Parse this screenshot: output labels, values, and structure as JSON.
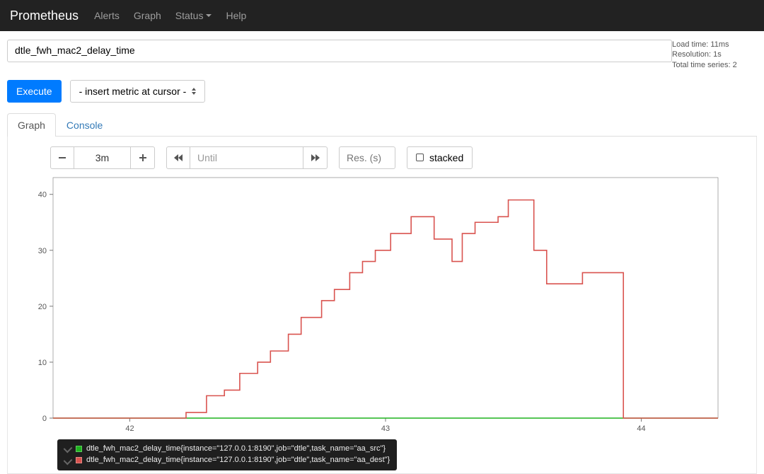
{
  "nav": {
    "brand": "Prometheus",
    "items": [
      "Alerts",
      "Graph",
      "Status",
      "Help"
    ]
  },
  "expression": "dtle_fwh_mac2_delay_time",
  "stats": {
    "load_time": "Load time: 11ms",
    "resolution": "Resolution: 1s",
    "total_series": "Total time series: 2"
  },
  "actions": {
    "execute": "Execute",
    "insert_metric": "- insert metric at cursor -"
  },
  "tabs": {
    "graph": "Graph",
    "console": "Console"
  },
  "controls": {
    "range": "3m",
    "until_placeholder": "Until",
    "res_placeholder": "Res. (s)",
    "stacked": "stacked"
  },
  "chart_data": {
    "type": "line",
    "x": [
      42,
      43,
      44
    ],
    "ylim": [
      0,
      40
    ],
    "yticks": [
      0,
      10,
      20,
      30,
      40
    ],
    "xticks": [
      42,
      43,
      44
    ],
    "series": [
      {
        "name": "dtle_fwh_mac2_delay_time{instance=\"127.0.0.1:8190\",job=\"dtle\",task_name=\"aa_src\"}",
        "color": "#1eb41e",
        "points": [
          [
            41.7,
            0
          ],
          [
            44.3,
            0
          ]
        ]
      },
      {
        "name": "dtle_fwh_mac2_delay_time{instance=\"127.0.0.1:8190\",job=\"dtle\",task_name=\"aa_dest\"}",
        "color": "#d9534f",
        "points": [
          [
            41.7,
            0
          ],
          [
            42.22,
            0
          ],
          [
            42.22,
            1
          ],
          [
            42.3,
            1
          ],
          [
            42.3,
            4
          ],
          [
            42.37,
            4
          ],
          [
            42.37,
            5
          ],
          [
            42.43,
            5
          ],
          [
            42.43,
            8
          ],
          [
            42.5,
            8
          ],
          [
            42.5,
            10
          ],
          [
            42.55,
            10
          ],
          [
            42.55,
            12
          ],
          [
            42.62,
            12
          ],
          [
            42.62,
            15
          ],
          [
            42.67,
            15
          ],
          [
            42.67,
            18
          ],
          [
            42.75,
            18
          ],
          [
            42.75,
            21
          ],
          [
            42.8,
            21
          ],
          [
            42.8,
            23
          ],
          [
            42.86,
            23
          ],
          [
            42.86,
            26
          ],
          [
            42.91,
            26
          ],
          [
            42.91,
            28
          ],
          [
            42.96,
            28
          ],
          [
            42.96,
            30
          ],
          [
            43.02,
            30
          ],
          [
            43.02,
            33
          ],
          [
            43.1,
            33
          ],
          [
            43.1,
            36
          ],
          [
            43.19,
            36
          ],
          [
            43.19,
            32
          ],
          [
            43.26,
            32
          ],
          [
            43.26,
            28
          ],
          [
            43.3,
            28
          ],
          [
            43.3,
            33
          ],
          [
            43.35,
            33
          ],
          [
            43.35,
            35
          ],
          [
            43.44,
            35
          ],
          [
            43.44,
            36
          ],
          [
            43.48,
            36
          ],
          [
            43.48,
            39
          ],
          [
            43.58,
            39
          ],
          [
            43.58,
            30
          ],
          [
            43.63,
            30
          ],
          [
            43.63,
            24
          ],
          [
            43.77,
            24
          ],
          [
            43.77,
            26
          ],
          [
            43.93,
            26
          ],
          [
            43.93,
            0
          ],
          [
            44.3,
            0
          ]
        ]
      }
    ]
  }
}
